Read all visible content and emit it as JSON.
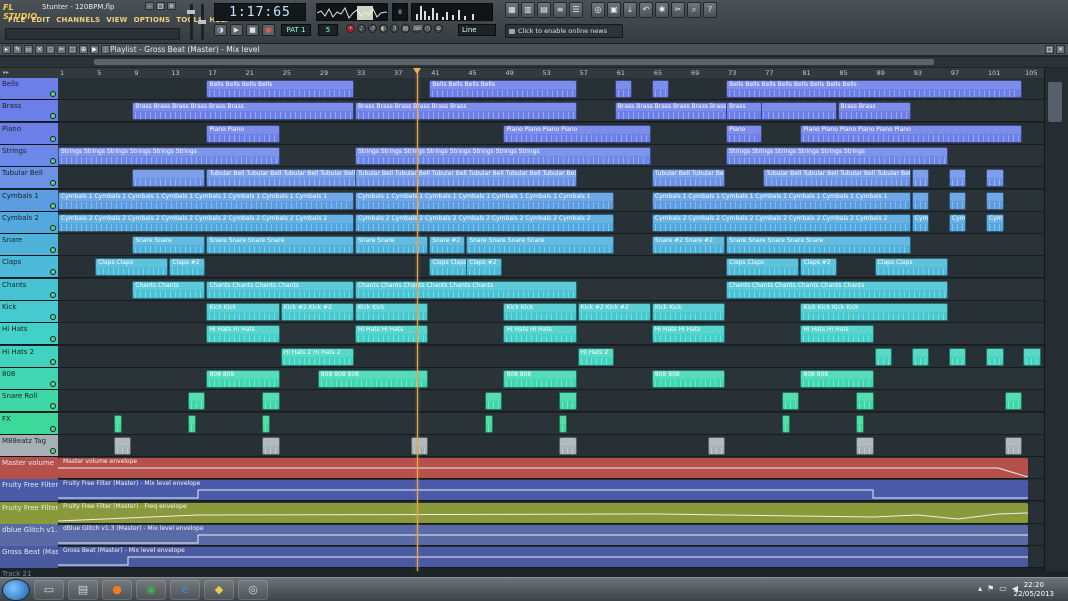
{
  "app": {
    "logo": "FL STUDIO",
    "song_file": "Stunter - 120BPM.flp",
    "menu": [
      "FILE",
      "EDIT",
      "CHANNELS",
      "VIEW",
      "OPTIONS",
      "TOOLS",
      "HELP"
    ],
    "time": "1:17:65",
    "pattern": "PAT 1",
    "tempo": "5",
    "line_mode": "Line",
    "news": "Click to enable online news",
    "cpu": "8"
  },
  "playlist": {
    "title": "Playlist - Gross Beat (Master) - Mix level",
    "ruler": [
      "1",
      "5",
      "9",
      "13",
      "17",
      "21",
      "25",
      "29",
      "33",
      "37",
      "41",
      "45",
      "49",
      "53",
      "57",
      "61",
      "65",
      "69",
      "73",
      "77",
      "81",
      "85",
      "89",
      "93",
      "97",
      "101",
      "105"
    ],
    "tracks": [
      {
        "name": "Bells",
        "color": "#6c7fe8"
      },
      {
        "name": "Brass",
        "color": "#6c7fe8"
      },
      {
        "name": "Piano",
        "color": "#6c7fe8"
      },
      {
        "name": "Strings",
        "color": "#6c88e8"
      },
      {
        "name": "Tubular Bell",
        "color": "#6c92e6"
      },
      {
        "name": "Cymbals 1",
        "color": "#5c9de2"
      },
      {
        "name": "Cymbals 2",
        "color": "#52a8df"
      },
      {
        "name": "Snare",
        "color": "#4fb2db"
      },
      {
        "name": "Claps",
        "color": "#4cbad8"
      },
      {
        "name": "Chants",
        "color": "#48c3d4"
      },
      {
        "name": "Kick",
        "color": "#46c9cf"
      },
      {
        "name": "Hi Hats",
        "color": "#43d0c8"
      },
      {
        "name": "Hi Hats 2",
        "color": "#41d3be"
      },
      {
        "name": "808",
        "color": "#3fd6b2"
      },
      {
        "name": "Snare Roll",
        "color": "#3ed8a6"
      },
      {
        "name": "FX",
        "color": "#3dd99a"
      },
      {
        "name": "M88eatz Tag",
        "color": "#a7b1b5"
      }
    ],
    "clip_labels": {
      "bells": "Bells",
      "brass": "Brass",
      "piano": "Piano",
      "strings": "Strings",
      "tubular": "Tubular Bell",
      "cym1": "Cymbals 1",
      "cym2": "Cymbals 2",
      "snare": "Snare",
      "snare2": "Snare #2",
      "claps": "Claps",
      "claps2": "Claps #2",
      "chants": "Chants",
      "kick": "Kick",
      "kick2": "Kick #2",
      "hats": "Hi Hats",
      "hats2": "Hi Hats 2",
      "b808": "808"
    },
    "envelopes": [
      {
        "name": "Master volume",
        "label": "Master volume envelope",
        "color": "#b5504a"
      },
      {
        "name": "Fruity Free Filter (...",
        "label": "Fruity Free Filter (Master) - Mix level envelope",
        "color": "#4a5aa8"
      },
      {
        "name": "Fruity Free Filter (...",
        "label": "Fruity Free Filter (Master) - Freq envelope",
        "color": "#8a9a3a"
      },
      {
        "name": "dblue Glitch v1.3 (...",
        "label": "dBlue Glitch v1.3 (Master) - Mix level envelope",
        "color": "#5a6aa6"
      },
      {
        "name": "Gross Beat (Master...",
        "label": "Gross Beat (Master) - Mix level envelope",
        "color": "#4a5aa0"
      }
    ],
    "footer_track": "Track 21"
  },
  "taskbar": {
    "time": "22:20",
    "date": "22/05/2013"
  }
}
